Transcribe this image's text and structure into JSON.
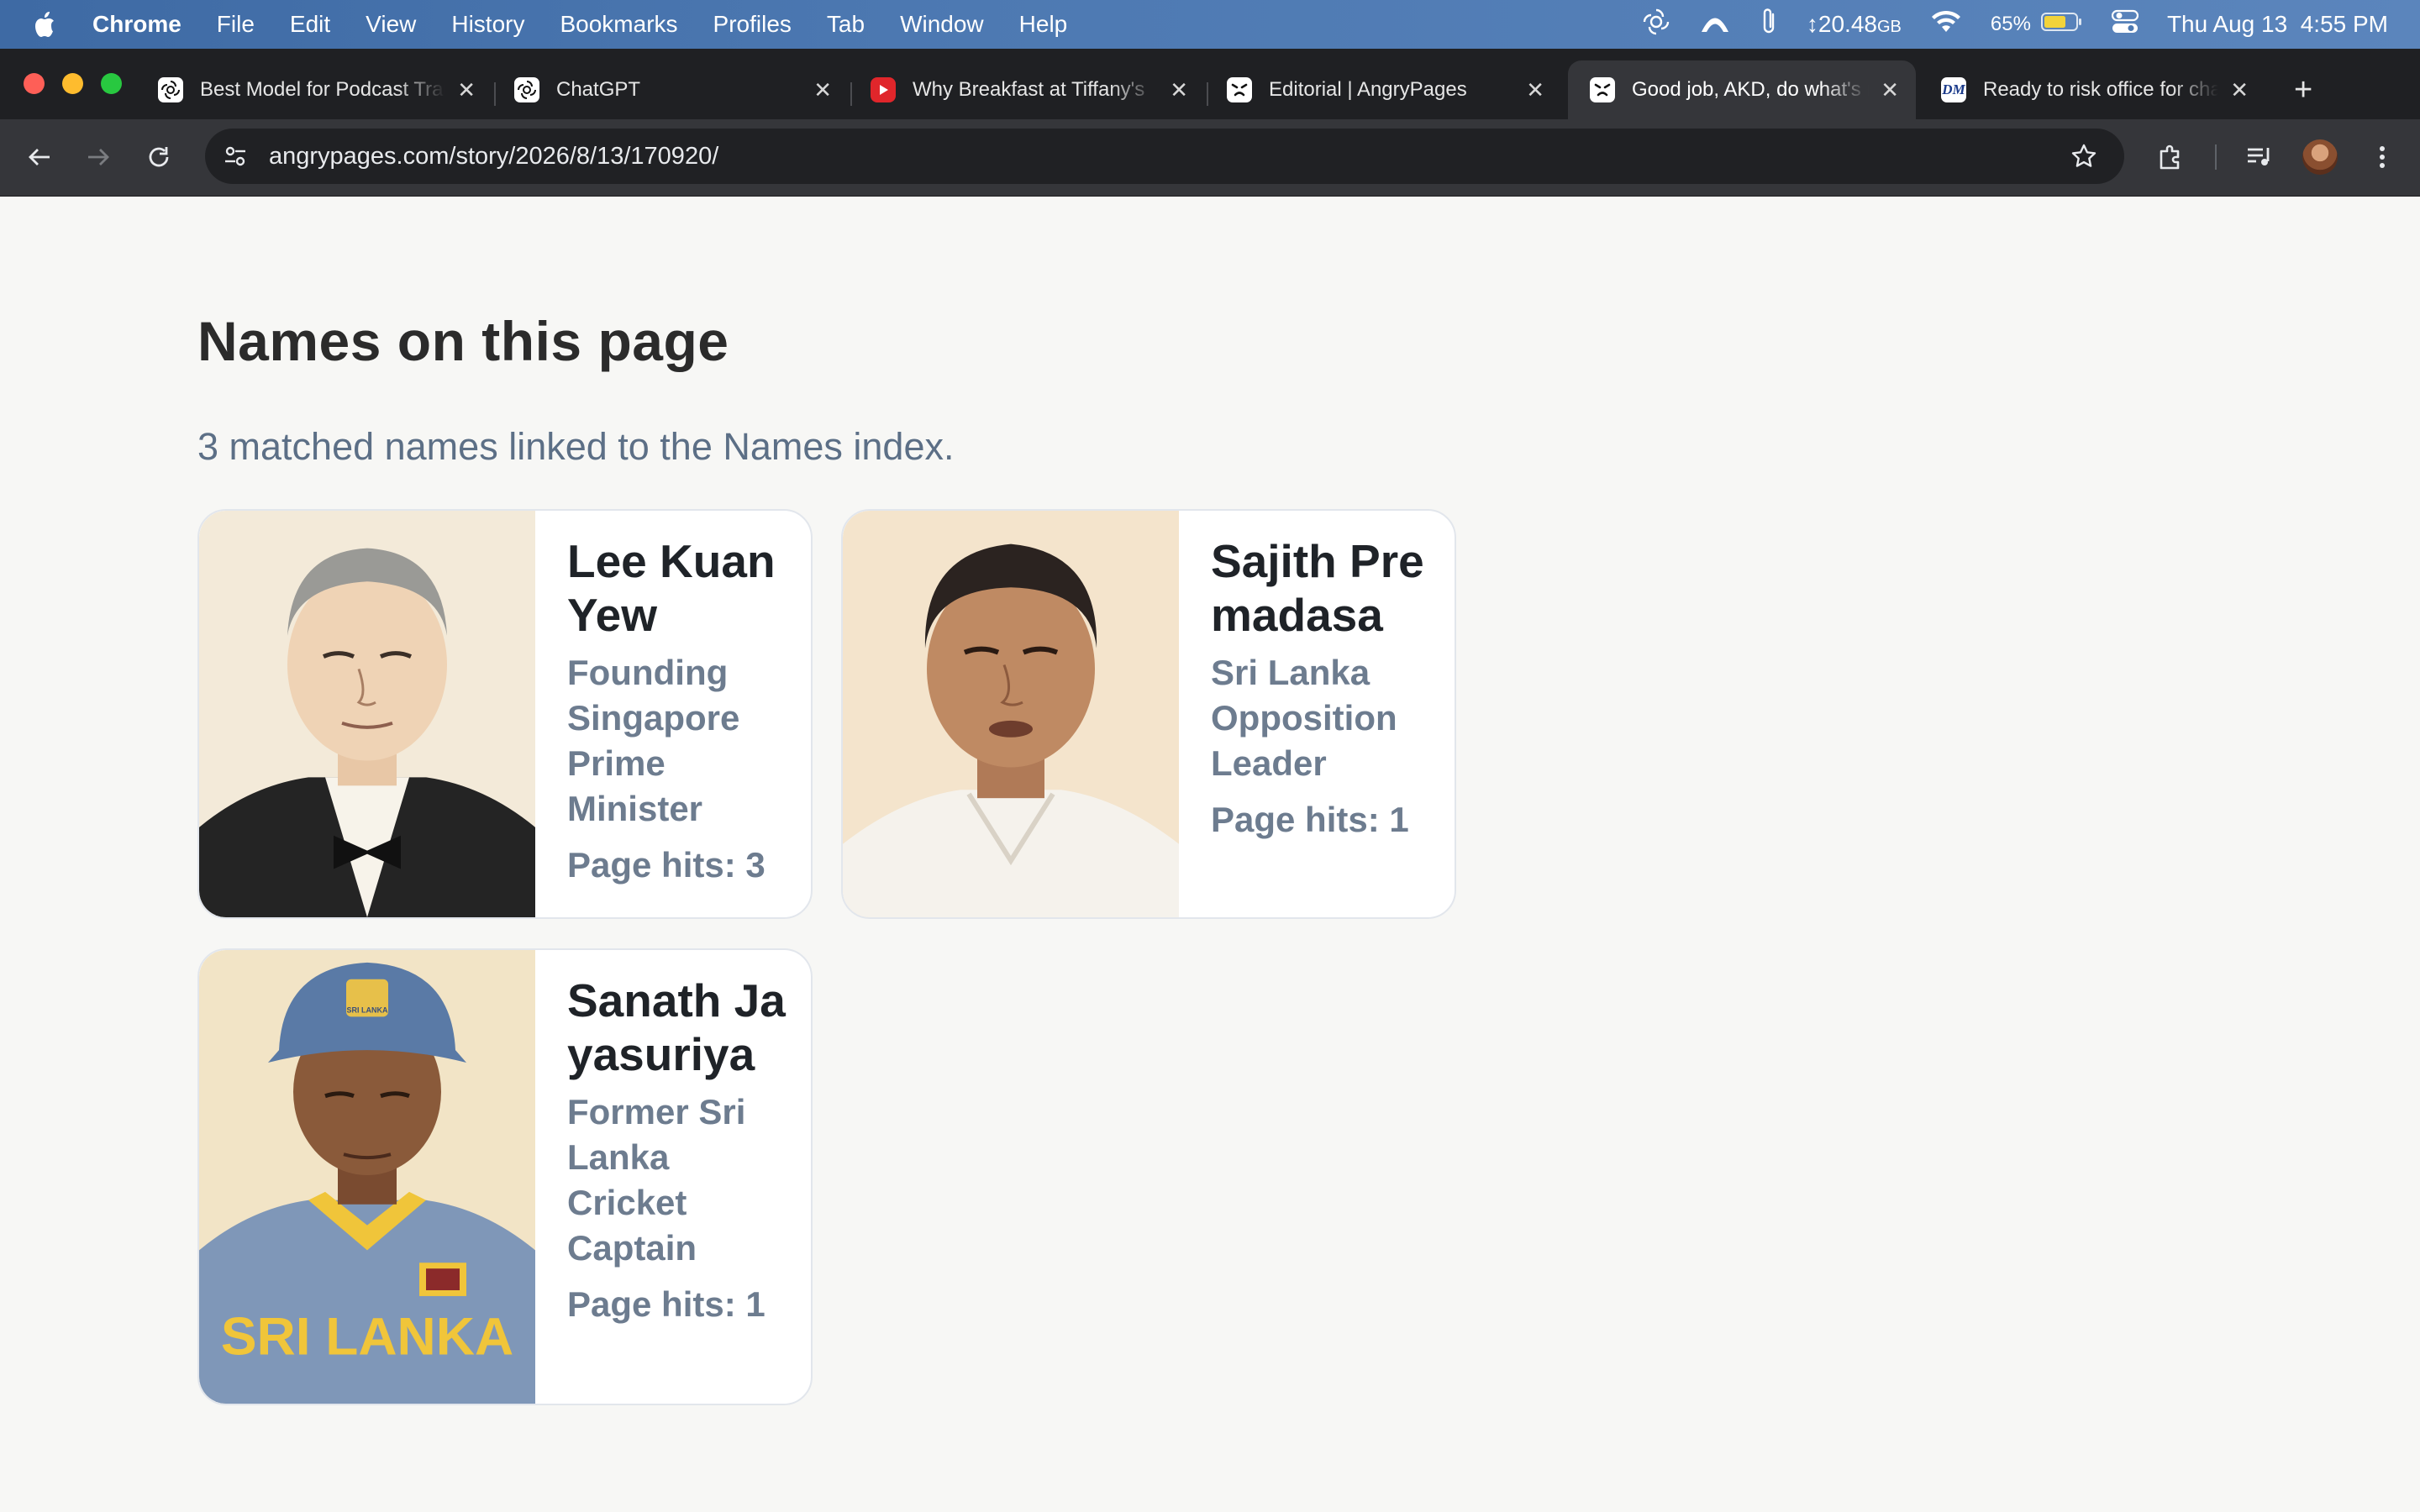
{
  "menubar": {
    "app": "Chrome",
    "items": [
      "File",
      "Edit",
      "View",
      "History",
      "Bookmarks",
      "Profiles",
      "Tab",
      "Window",
      "Help"
    ],
    "storage_value": "20.48",
    "storage_unit": "GB",
    "battery": "65%",
    "datetime": "Thu Aug 13  4:55 PM"
  },
  "tabs": [
    {
      "title": "Best Model for Podcast Transcription",
      "favicon": "openai-icon",
      "active": false
    },
    {
      "title": "ChatGPT",
      "favicon": "openai-icon",
      "active": false
    },
    {
      "title": "Why Breakfast at Tiffany's",
      "favicon": "youtube-icon",
      "active": false
    },
    {
      "title": "Editorial | AngryPages",
      "favicon": "angrypages-icon",
      "active": false
    },
    {
      "title": "Good job, AKD, do what's right",
      "favicon": "angrypages-icon",
      "active": true
    },
    {
      "title": "Ready to risk office for change",
      "favicon": "dm-icon",
      "active": false
    }
  ],
  "toolbar": {
    "url": "angrypages.com/story/2026/8/13/170920/"
  },
  "page": {
    "title": "Names on this page",
    "subtitle": "3 matched names linked to the Names index.",
    "people": [
      {
        "name": "Lee Kuan Yew",
        "role": "Founding Singapore Prime Minister",
        "hits": "Page hits: 3"
      },
      {
        "name": "Sajith Premadasa",
        "role": "Sri Lanka Opposition Leader",
        "hits": "Page hits: 1"
      },
      {
        "name": "Sanath Jayasuriya",
        "role": "Former Sri Lanka Cricket Captain",
        "hits": "Page hits: 1",
        "jersey_text": "SRI LANKA",
        "cap_text": "SRI LANKA"
      }
    ]
  },
  "colors": {
    "menubar": "#4d79b2",
    "tabstrip": "#1f2023",
    "toolbar": "#35363a",
    "page_bg": "#f7f7f5",
    "name_text": "#1f2328",
    "role_text": "#6d7c8f"
  }
}
